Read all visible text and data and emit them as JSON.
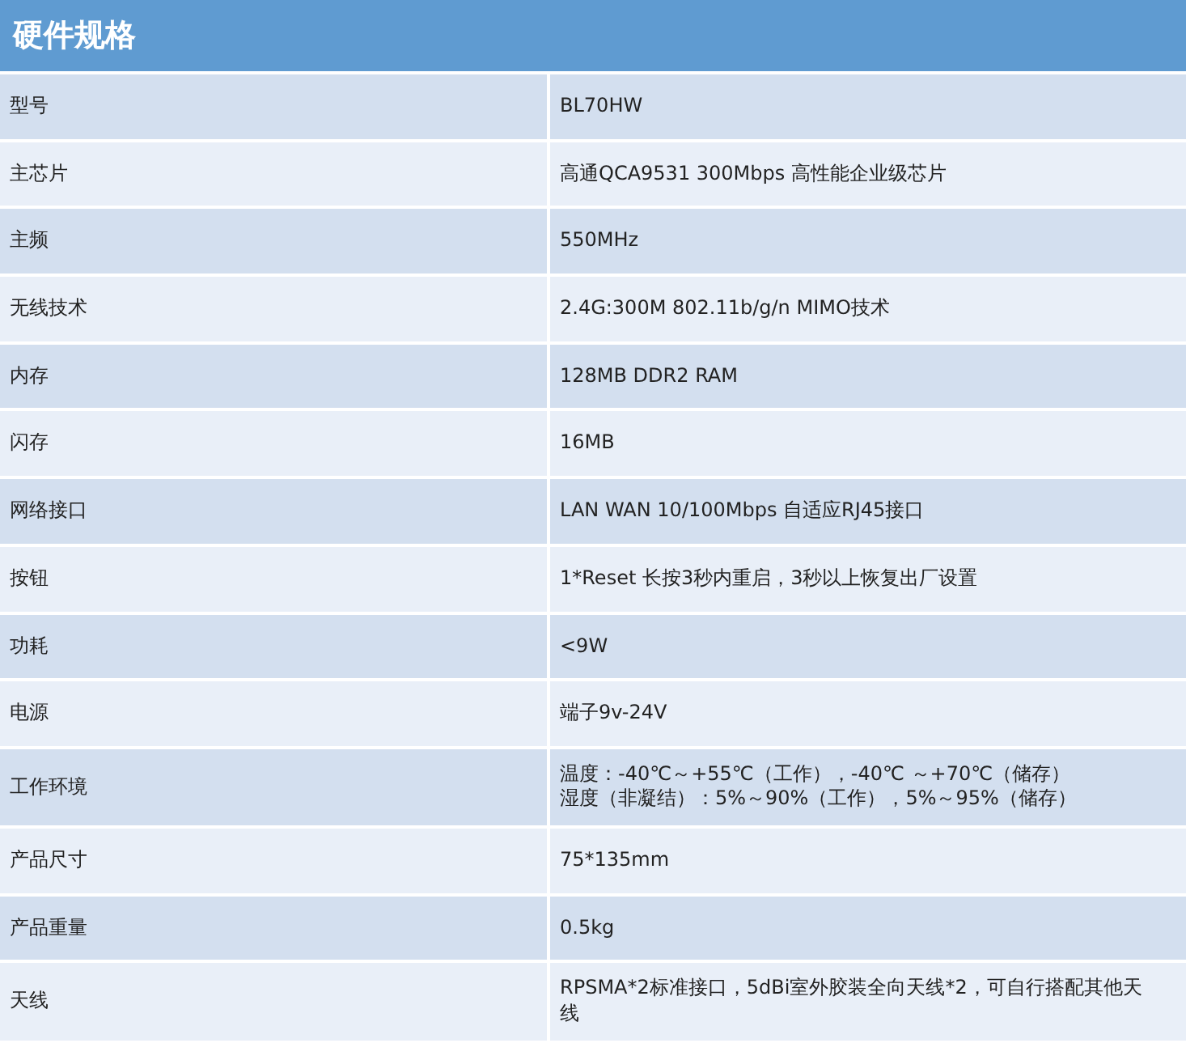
{
  "title": "硬件规格",
  "rows": [
    {
      "label": "型号",
      "value": "BL70HW"
    },
    {
      "label": "主芯片",
      "value": "高通QCA9531 300Mbps 高性能企业级芯片"
    },
    {
      "label": "主频",
      "value": "550MHz"
    },
    {
      "label": "无线技术",
      "value": "2.4G:300M 802.11b/g/n MIMO技术"
    },
    {
      "label": "内存",
      "value": "128MB DDR2 RAM"
    },
    {
      "label": "闪存",
      "value": "16MB"
    },
    {
      "label": "网络接口",
      "value": "LAN WAN 10/100Mbps 自适应RJ45接口"
    },
    {
      "label": "按钮",
      "value": "1*Reset 长按3秒内重启，3秒以上恢复出厂设置"
    },
    {
      "label": "功耗",
      "value": "<9W"
    },
    {
      "label": "电源",
      "value": "端子9v-24V"
    },
    {
      "label": "工作环境",
      "lines": [
        "温度：-40℃～+55℃（工作），-40℃ ～+70℃（储存）",
        "湿度（非凝结）：5%～90%（工作），5%～95%（储存）"
      ]
    },
    {
      "label": "产品尺寸",
      "value": "75*135mm"
    },
    {
      "label": "产品重量",
      "value": "0.5kg"
    },
    {
      "label": "天线",
      "value": "RPSMA*2标准接口，5dBi室外胶装全向天线*2，可自行搭配其他天线"
    }
  ]
}
